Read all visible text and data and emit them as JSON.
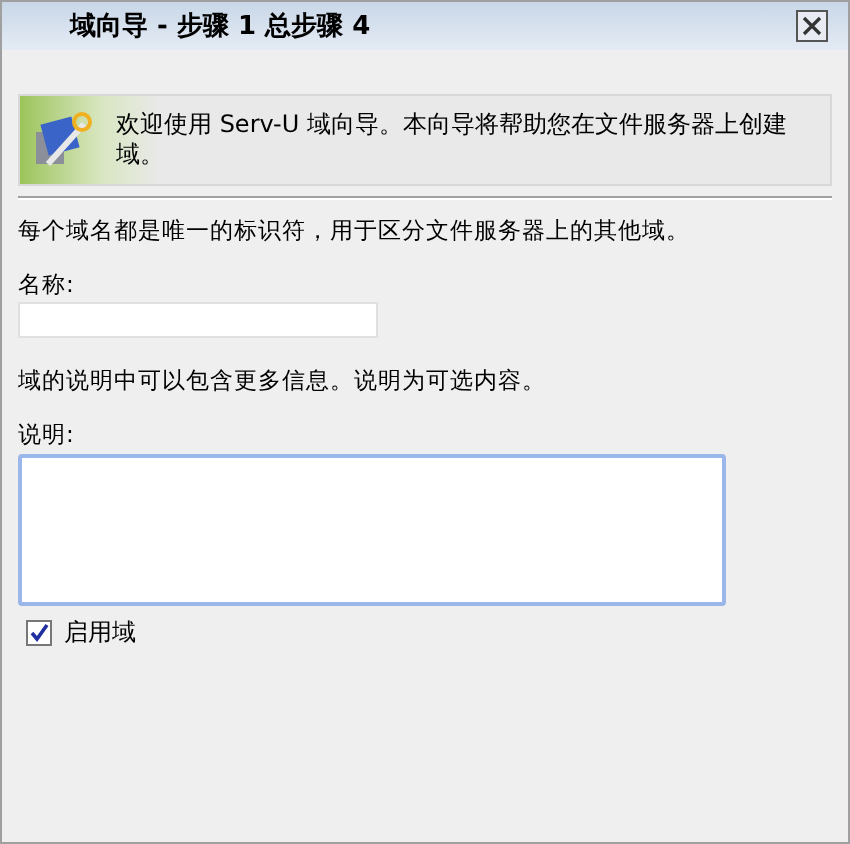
{
  "window": {
    "title": "域向导 - 步骤 1 总步骤 4"
  },
  "banner": {
    "text": "欢迎使用 Serv-U 域向导。本向导将帮助您在文件服务器上创建域。"
  },
  "intro": "每个域名都是唯一的标识符，用于区分文件服务器上的其他域。",
  "name_field": {
    "label": "名称:"
  },
  "description_hint": "域的说明中可以包含更多信息。说明为可选内容。",
  "description_field": {
    "label": "说明:"
  },
  "enable_checkbox": {
    "label": "启用域",
    "checked": true
  }
}
